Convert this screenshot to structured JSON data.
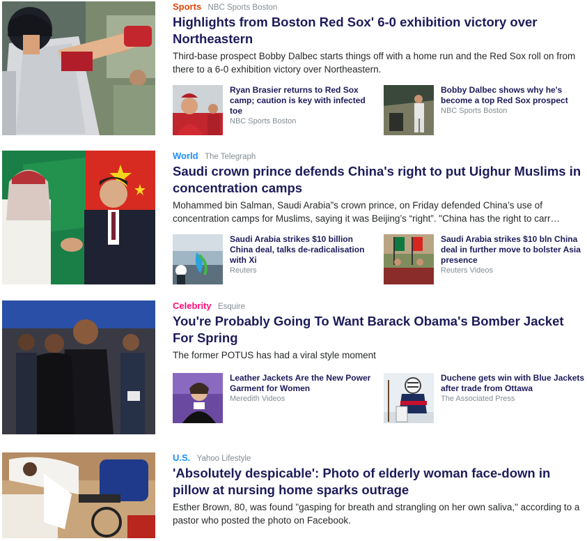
{
  "stories": [
    {
      "category": "Sports",
      "category_color": "#e0460a",
      "source": "NBC Sports Boston",
      "headline": "Highlights from Boston Red Sox' 6-0 exhibition victory over Northeastern",
      "summary": "Third-base prospect Bobby Dalbec starts things off with a home run and the Red Sox roll on from there to a 6-0 exhibition victory over Northeastern.",
      "image": "baseball-batter-photo",
      "related": [
        {
          "title": "Ryan Brasier returns to Red Sox camp; caution is key with infected toe",
          "source": "NBC Sports Boston",
          "image": "red-sox-players-photo"
        },
        {
          "title": "Bobby Dalbec shows why he's become a top Red Sox prospect",
          "source": "NBC Sports Boston",
          "image": "batter-at-plate-photo"
        }
      ]
    },
    {
      "category": "World",
      "category_color": "#188fff",
      "source": "The Telegraph",
      "headline": "Saudi crown prince defends China's right to put Uighur Muslims in concentration camps",
      "summary": "Mohammed bin Salman, Saudi Arabia”s crown prince, on Friday defended China’s use of concentration camps for Muslims, saying it was Beijing’s “right”. \"China has the right to carr…",
      "image": "leaders-handshake-photo",
      "related": [
        {
          "title": "Saudi Arabia strikes $10 billion China deal, talks de-radicalisation with Xi",
          "source": "Reuters",
          "image": "aramco-logo-photo"
        },
        {
          "title": "Saudi Arabia strikes $10 bln China deal in further move to bolster Asia presence",
          "source": "Reuters Videos",
          "image": "ceremony-flags-photo"
        }
      ]
    },
    {
      "category": "Celebrity",
      "category_color": "#ff0c78",
      "source": "Esquire",
      "headline": "You're Probably Going To Want Barack Obama's Bomber Jacket For Spring",
      "summary": "The former POTUS has had a viral style moment",
      "image": "crowd-at-game-photo",
      "related": [
        {
          "title": "Leather Jackets Are the New Power Garment for Women",
          "source": "Meredith Videos",
          "image": "woman-speaker-photo"
        },
        {
          "title": "Duchene gets win with Blue Jackets after trade from Ottawa",
          "source": "The Associated Press",
          "image": "hockey-goalie-photo"
        }
      ]
    },
    {
      "category": "U.S.",
      "category_color": "#188fff",
      "source": "Yahoo Lifestyle",
      "headline": "'Absolutely despicable': Photo of elderly woman face-down in pillow at nursing home sparks outrage",
      "summary": "Esther Brown, 80, was found \"gasping for breath and strangling on her own saliva,\" according to a pastor who posted the photo on Facebook.",
      "image": "nursing-home-photo",
      "related": []
    }
  ]
}
